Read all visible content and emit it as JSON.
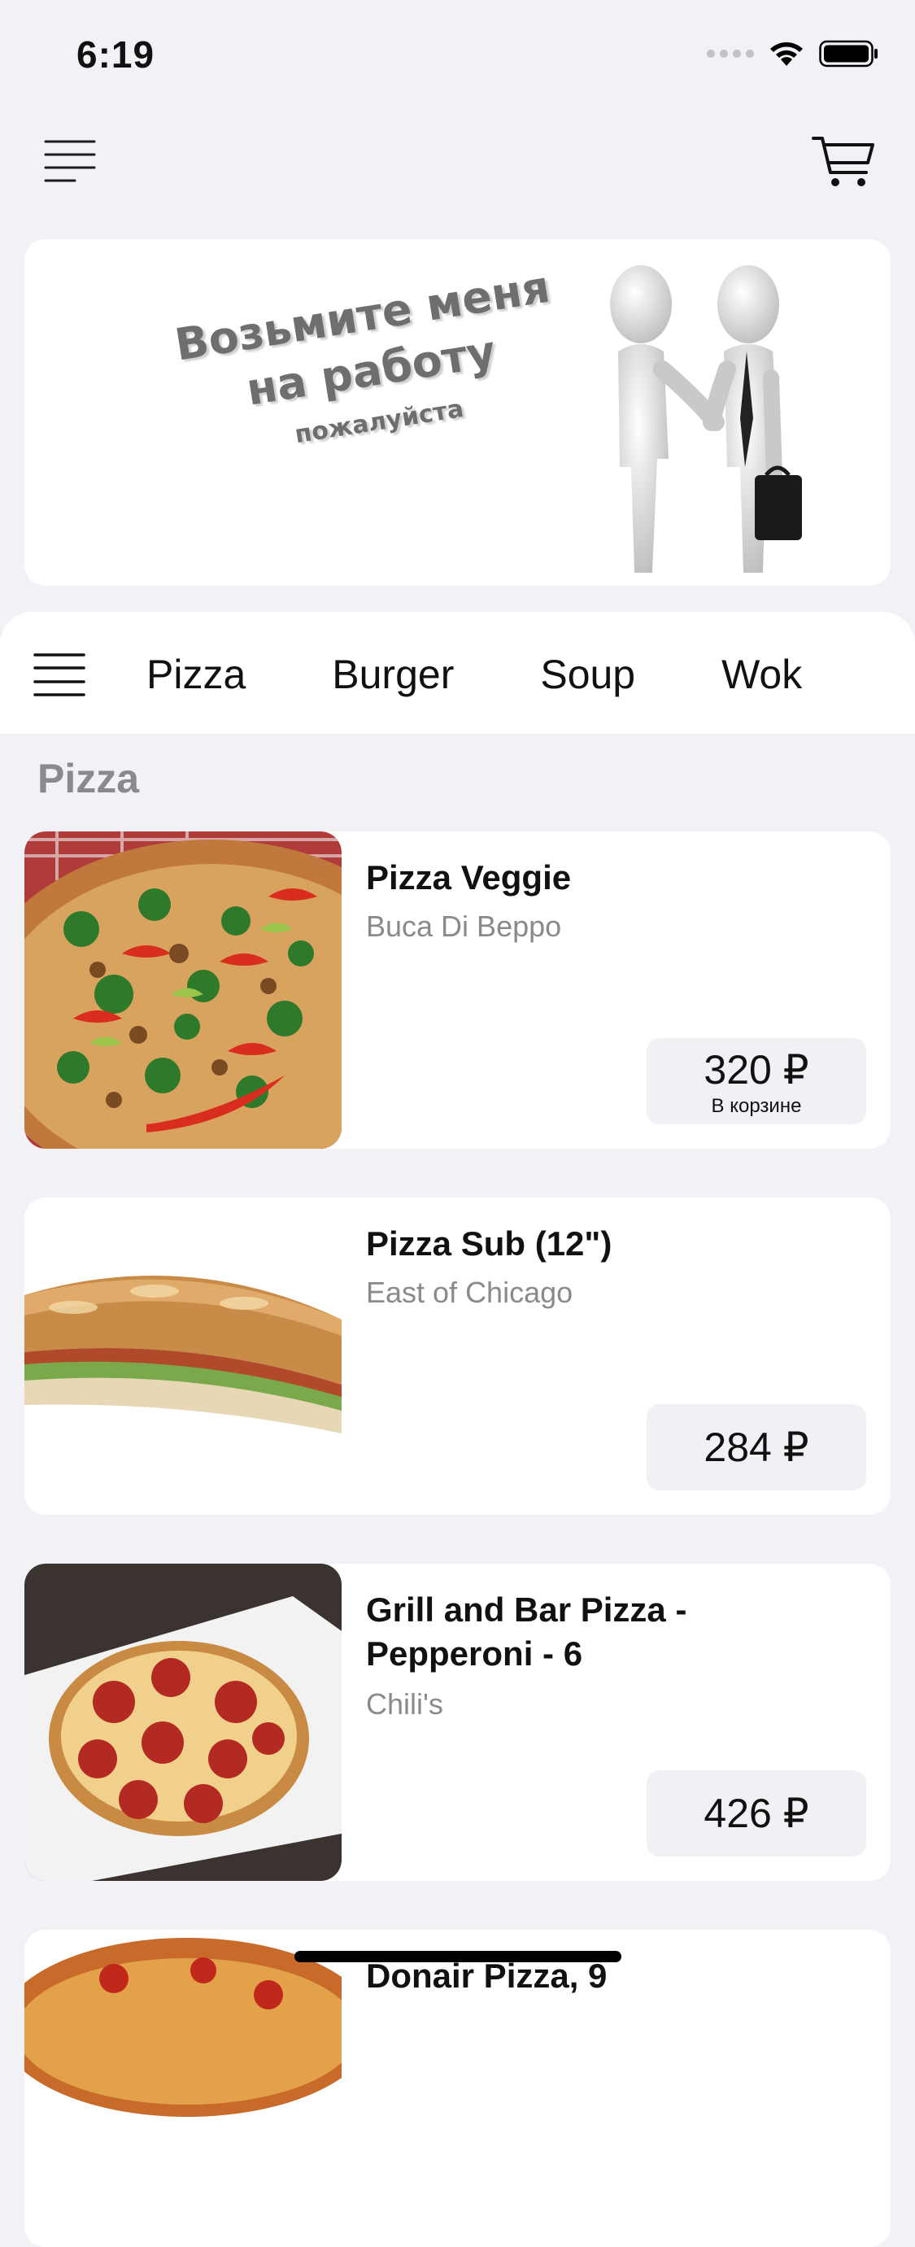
{
  "status_bar": {
    "time": "6:19"
  },
  "header": {
    "menu_icon": "menu-lines-icon",
    "cart_icon": "cart-icon"
  },
  "banner": {
    "line1": "Возьмите меня на работу",
    "line2": "пожалуйста"
  },
  "categories": [
    "Pizza",
    "Burger",
    "Soup",
    "Wok"
  ],
  "section_title": "Pizza",
  "products": [
    {
      "title": "Pizza Veggie",
      "vendor": "Buca Di Beppo",
      "price": "320 ₽",
      "note": "В корзине"
    },
    {
      "title": "Pizza Sub (12\")",
      "vendor": "East of Chicago",
      "price": "284 ₽"
    },
    {
      "title": "Grill and Bar Pizza - Pepperoni - 6",
      "vendor": "Chili's",
      "price": "426 ₽"
    },
    {
      "title": "Donair Pizza, 9"
    }
  ],
  "colors": {
    "background": "#f1f1f6",
    "card": "#ffffff",
    "secondary_text": "#8a8a8e",
    "price_button": "#f0f0f5"
  }
}
